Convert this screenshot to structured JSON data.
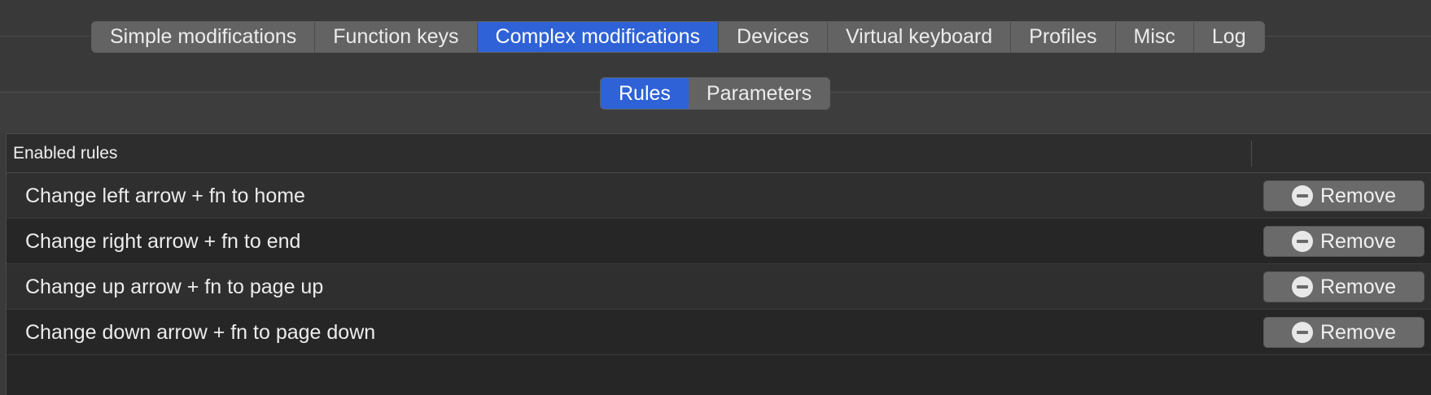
{
  "tabs": [
    {
      "label": "Simple modifications",
      "active": false
    },
    {
      "label": "Function keys",
      "active": false
    },
    {
      "label": "Complex modifications",
      "active": true
    },
    {
      "label": "Devices",
      "active": false
    },
    {
      "label": "Virtual keyboard",
      "active": false
    },
    {
      "label": "Profiles",
      "active": false
    },
    {
      "label": "Misc",
      "active": false
    },
    {
      "label": "Log",
      "active": false
    }
  ],
  "subtabs": [
    {
      "label": "Rules",
      "active": true
    },
    {
      "label": "Parameters",
      "active": false
    }
  ],
  "table": {
    "header": "Enabled rules",
    "rows": [
      {
        "name": "Change left arrow + fn to home",
        "action": "Remove"
      },
      {
        "name": "Change right arrow + fn to end",
        "action": "Remove"
      },
      {
        "name": "Change up arrow + fn to page up",
        "action": "Remove"
      },
      {
        "name": "Change down arrow + fn to page down",
        "action": "Remove"
      }
    ]
  },
  "colors": {
    "accent": "#2f62d6",
    "background": "#3a3a3a",
    "table_background": "#262626"
  },
  "icons": {
    "remove": "minus-circle-icon"
  }
}
